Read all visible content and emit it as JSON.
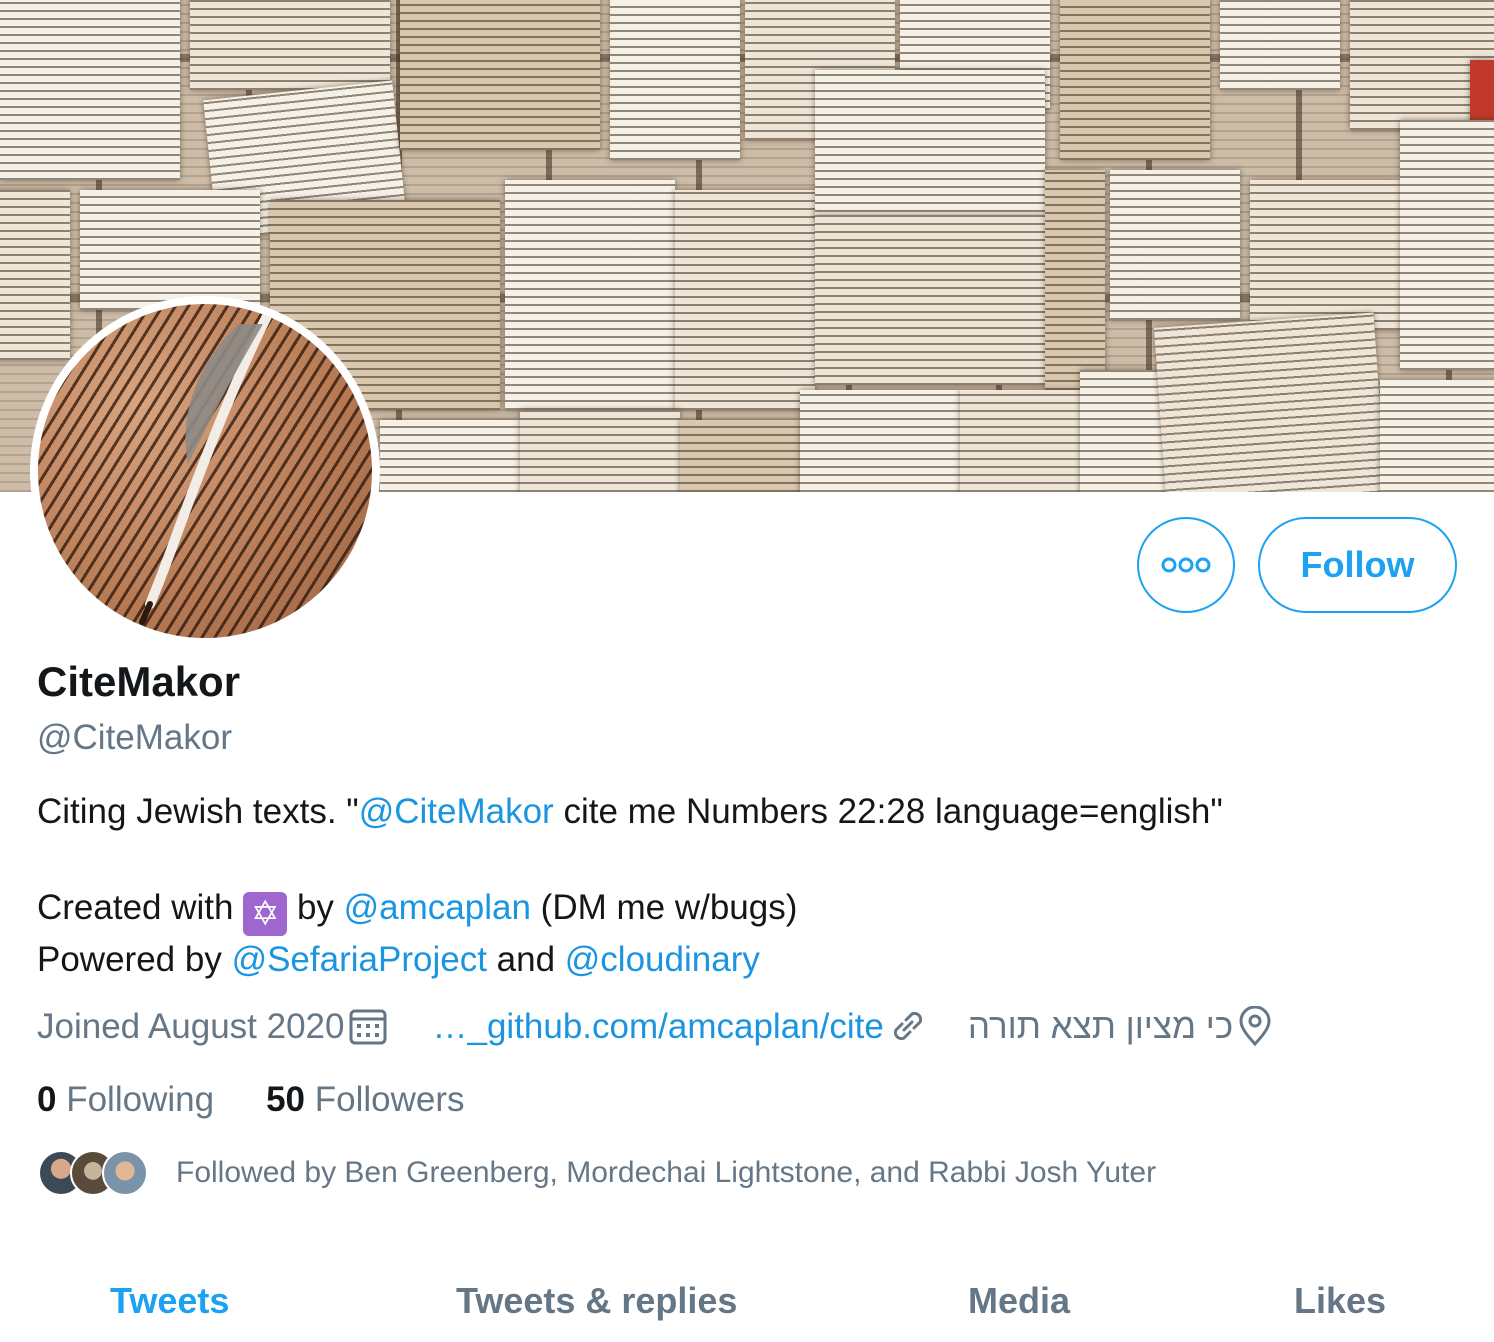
{
  "profile": {
    "display_name": "CiteMakor",
    "handle": "@CiteMakor"
  },
  "actions": {
    "follow_label": "Follow",
    "more_icon": "more-dots-icon"
  },
  "bio": {
    "line1_prefix": "Citing Jewish texts. \"",
    "line1_mention": "@CiteMakor",
    "line1_suffix": " cite me Numbers 22:28 language=english\"",
    "line2_prefix": "Created with ",
    "line2_emoji": "✡",
    "line2_by": " by ",
    "line2_mention": "@amcaplan",
    "line2_suffix": " (DM me w/bugs)",
    "line3_prefix": "Powered by ",
    "line3_mention1": "@SefariaProject",
    "line3_and": " and ",
    "line3_mention2": "@cloudinary"
  },
  "meta": {
    "joined": "Joined August 2020",
    "url": "…_github.com/amcaplan/cite",
    "location": "כי מציון תצא תורה",
    "calendar_icon": "calendar-icon",
    "link_icon": "link-icon",
    "location_icon": "location-pin-icon"
  },
  "stats": {
    "following_count": "0",
    "following_label": "Following",
    "followers_count": "50",
    "followers_label": "Followers"
  },
  "followed_by": {
    "text": "Followed by Ben Greenberg, Mordechai Lightstone, and Rabbi Josh Yuter"
  },
  "tabs": [
    {
      "label": "Tweets",
      "active": true
    },
    {
      "label": "Tweets & replies",
      "active": false
    },
    {
      "label": "Media",
      "active": false
    },
    {
      "label": "Likes",
      "active": false
    }
  ],
  "colors": {
    "accent": "#1da1f2",
    "link": "#1b95e0",
    "secondary_text": "#657786",
    "primary_text": "#14171a"
  }
}
